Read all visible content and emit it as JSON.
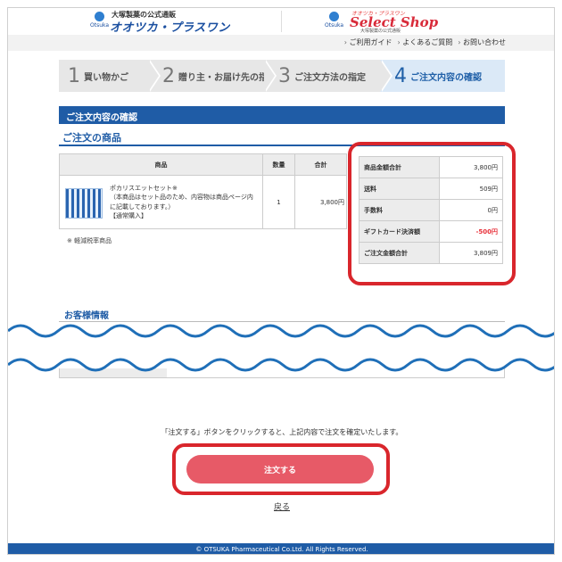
{
  "header": {
    "logo1_sub": "大塚製薬の公式通販",
    "logo1_main": "オオツカ・プラスワン",
    "otsuka_mark": "Otsuka",
    "logo2_small": "オオツカ・プラスワン",
    "logo2_main": "Select Shop",
    "logo2_tiny": "大塚製薬の公式通販"
  },
  "subnav": {
    "links": [
      "ご利用ガイド",
      "よくあるご質問",
      "お問い合わせ"
    ]
  },
  "steps": [
    {
      "num": "1",
      "label": "買い物かご"
    },
    {
      "num": "2",
      "label": "贈り主・お届け先の指定"
    },
    {
      "num": "3",
      "label": "ご注文方法の指定"
    },
    {
      "num": "4",
      "label": "ご注文内容の確認"
    }
  ],
  "section_title": "ご注文内容の確認",
  "products_title": "ご注文の商品",
  "product_table": {
    "headers": [
      "商品",
      "数量",
      "合計"
    ],
    "rows": [
      {
        "name": "ポカリスエットセット※",
        "desc": "（本商品はセット品のため、内容物は商品ページ内に記載しております。）",
        "type": "【通常購入】",
        "qty": "1",
        "total": "3,800円"
      }
    ]
  },
  "tax_note": "※ 軽減税率商品",
  "summary": [
    {
      "label": "商品金額合計",
      "value": "3,800円"
    },
    {
      "label": "送料",
      "value": "509円"
    },
    {
      "label": "手数料",
      "value": "0円"
    },
    {
      "label": "ギフトカード決済額",
      "value": "-500円"
    },
    {
      "label": "ご注文金額合計",
      "value": "3,809円"
    }
  ],
  "customer_title": "お客様情報",
  "instruction": "「注文する」ボタンをクリックすると、上記内容で注文を確定いたします。",
  "order_button": "注文する",
  "back_link": "戻る",
  "footer": "© OTSUKA Pharmaceutical Co.Ltd. All Rights Reserved.",
  "colors": {
    "primary": "#1f5ca6",
    "order_button": "#e75a67",
    "highlight": "#d9262c",
    "negative": "#e8303a"
  }
}
